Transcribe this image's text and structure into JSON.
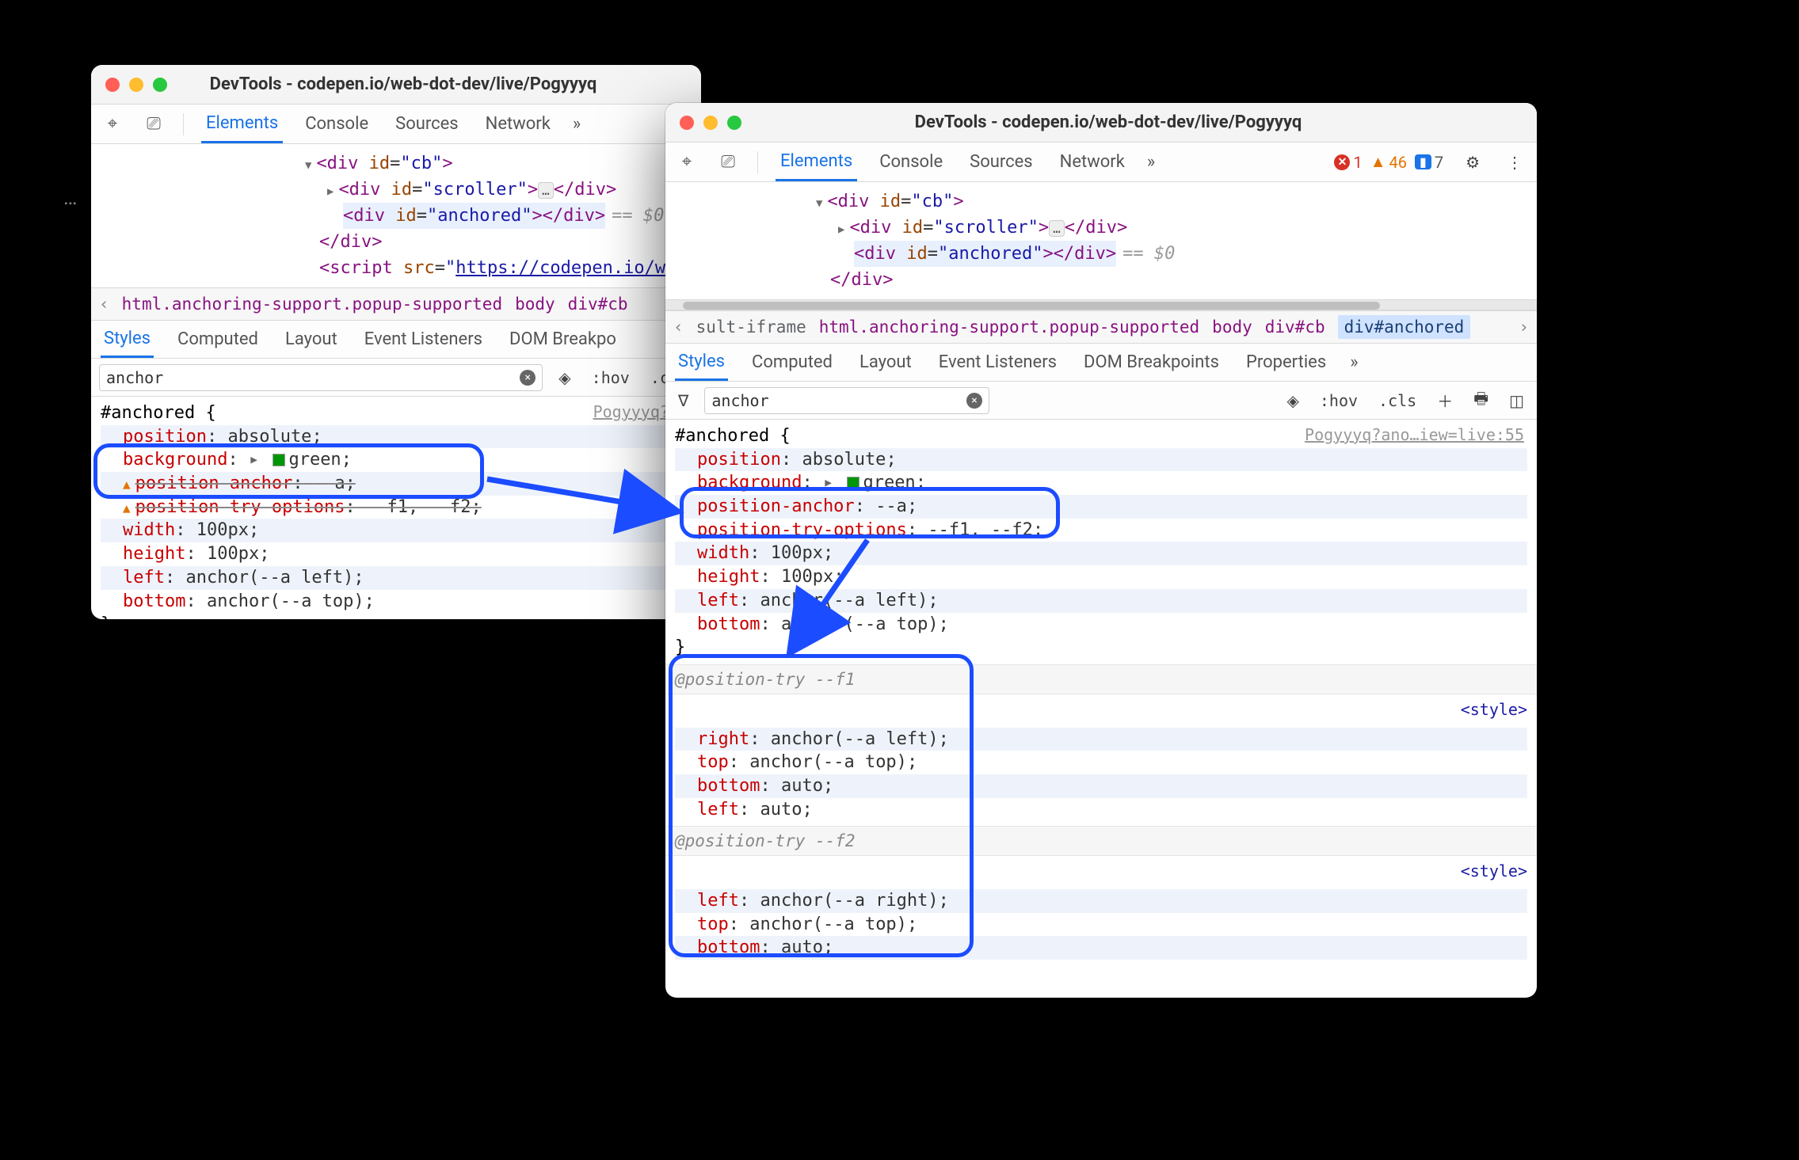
{
  "colors": {
    "accent": "#1a73e8",
    "annot": "#1b4cff"
  },
  "left": {
    "title": "DevTools - codepen.io/web-dot-dev/live/Pogyyyq",
    "tabs": [
      "Elements",
      "Console",
      "Sources",
      "Network"
    ],
    "activeTab": "Elements",
    "overflow": "»",
    "elements": {
      "line1_open": "<div id=\"cb\">",
      "line2": "<div id=\"scroller\">…</div>",
      "line3": "<div id=\"anchored\"></div>",
      "line3_suffix": "== $0",
      "line4_close": "</div>",
      "line5_script_pre": "<script src=\"",
      "line5_script_url": "https://codepen.io/web-dot-d",
      "ellipsis_token": "…"
    },
    "crumbs": [
      "html.anchoring-support.popup-supported",
      "body",
      "div#cb"
    ],
    "crumb_left_chev": "‹",
    "subtabs": [
      "Styles",
      "Computed",
      "Layout",
      "Event Listeners",
      "DOM Breakpo"
    ],
    "filter": {
      "value": "anchor",
      "hov": ":hov",
      "cls": ".cls"
    },
    "styles": {
      "selector": "#anchored {",
      "srclink": "Pogyyyq?an",
      "rows": [
        {
          "prop": "position",
          "val": "absolute"
        },
        {
          "prop": "background",
          "val": "green",
          "swatch": true,
          "caret": true
        },
        {
          "prop": "position-anchor",
          "val": "--a",
          "strike": true,
          "warn": true
        },
        {
          "prop": "position-try-options",
          "val": "--f1, --f2",
          "strike": true,
          "warn": true
        },
        {
          "prop": "width",
          "val": "100px"
        },
        {
          "prop": "height",
          "val": "100px"
        },
        {
          "prop": "left",
          "val": "anchor(--a left)"
        },
        {
          "prop": "bottom",
          "val": "anchor(--a top)"
        }
      ],
      "close": "}"
    }
  },
  "right": {
    "title": "DevTools - codepen.io/web-dot-dev/live/Pogyyyq",
    "tabs": [
      "Elements",
      "Console",
      "Sources",
      "Network"
    ],
    "activeTab": "Elements",
    "overflow": "»",
    "issues": {
      "errors": "1",
      "warnings": "46",
      "messages": "7"
    },
    "elements": {
      "line1_open": "<div id=\"cb\">",
      "line2": "<div id=\"scroller\">…</div>",
      "line3": "<div id=\"anchored\"></div>",
      "line3_suffix": "== $0",
      "line4_close": "</div>",
      "ellipsis_token": "…"
    },
    "crumbs_pre": "sult-iframe",
    "crumbs": [
      "html.anchoring-support.popup-supported",
      "body",
      "div#cb",
      "div#anchored"
    ],
    "crumb_selected": "div#anchored",
    "subtabs": [
      "Styles",
      "Computed",
      "Layout",
      "Event Listeners",
      "DOM Breakpoints",
      "Properties"
    ],
    "filter": {
      "value": "anchor",
      "hov": ":hov",
      "cls": ".cls"
    },
    "styles": {
      "selector": "#anchored {",
      "srclink": "Pogyyyq?ano…iew=live:55",
      "rows": [
        {
          "prop": "position",
          "val": "absolute"
        },
        {
          "prop": "background",
          "val": "green",
          "swatch": true,
          "caret": true
        },
        {
          "prop": "position-anchor",
          "val": "--a"
        },
        {
          "prop": "position-try-options",
          "val": "--f1, --f2"
        },
        {
          "prop": "width",
          "val": "100px"
        },
        {
          "prop": "height",
          "val": "100px"
        },
        {
          "prop": "left",
          "val": "anchor(--a left)"
        },
        {
          "prop": "bottom",
          "val": "anchor(--a top)"
        }
      ],
      "close": "}"
    },
    "try_sections": [
      {
        "name": "@position-try --f1",
        "rows": [
          {
            "prop": "right",
            "val": "anchor(--a left)"
          },
          {
            "prop": "top",
            "val": "anchor(--a top)"
          },
          {
            "prop": "bottom",
            "val": "auto"
          },
          {
            "prop": "left",
            "val": "auto"
          }
        ]
      },
      {
        "name": "@position-try --f2",
        "rows": [
          {
            "prop": "left",
            "val": "anchor(--a right)"
          },
          {
            "prop": "top",
            "val": "anchor(--a top)"
          },
          {
            "prop": "bottom",
            "val": "auto"
          }
        ]
      }
    ],
    "style_tag_label": "<style>"
  }
}
